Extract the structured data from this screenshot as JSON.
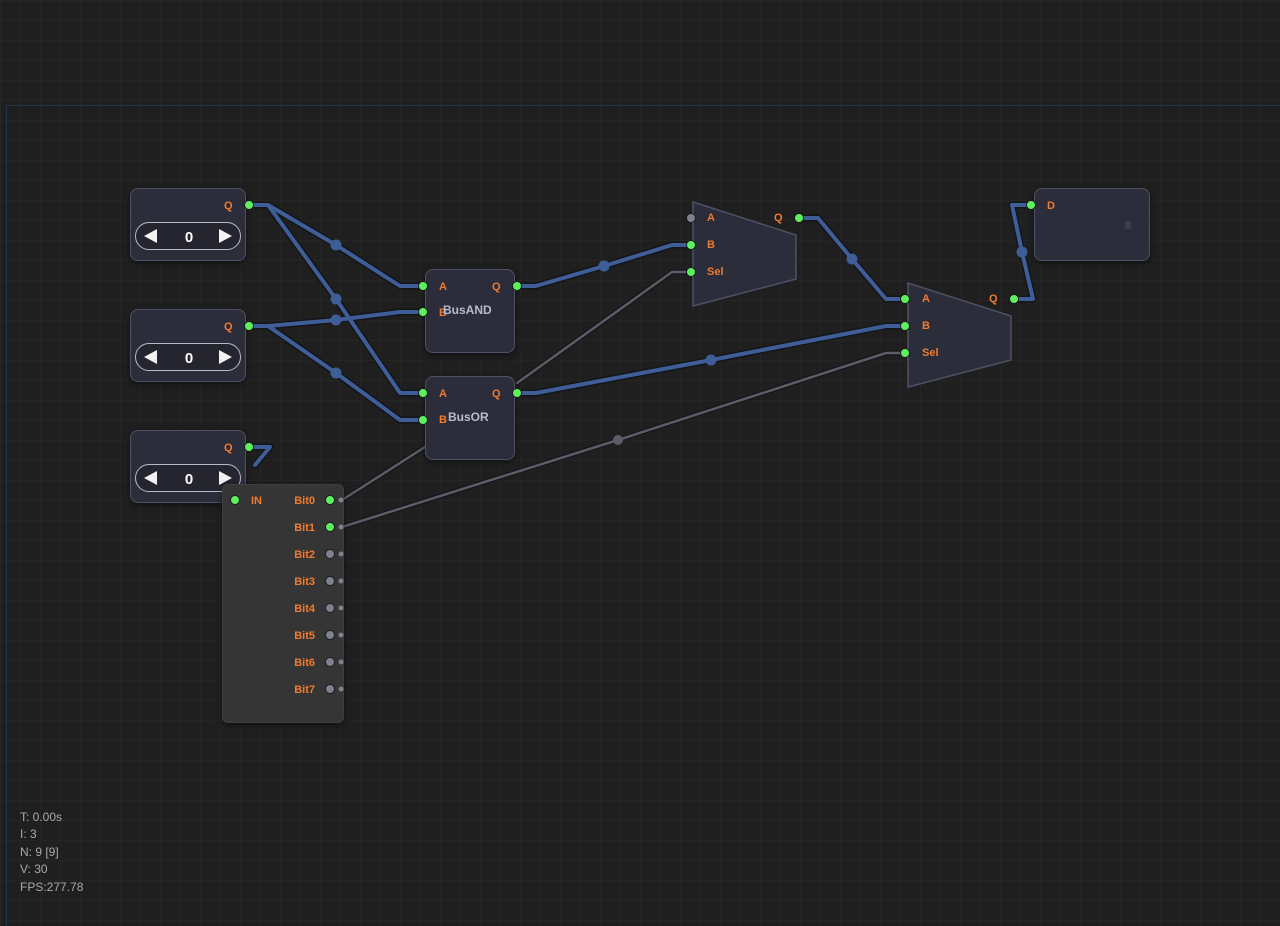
{
  "inputs": [
    {
      "output_label": "Q",
      "value": "0"
    },
    {
      "output_label": "Q",
      "value": "0"
    },
    {
      "output_label": "Q",
      "value": "0"
    }
  ],
  "gates": {
    "bus_and": {
      "name": "BusAND",
      "in_a": "A",
      "in_b": "B",
      "out": "Q"
    },
    "bus_or": {
      "name": "BusOR",
      "in_a": "A",
      "in_b": "B",
      "out": "Q"
    }
  },
  "mux1": {
    "in_a": "A",
    "in_b": "B",
    "in_sel": "Sel",
    "out": "Q"
  },
  "mux2": {
    "in_a": "A",
    "in_b": "B",
    "in_sel": "Sel",
    "out": "Q"
  },
  "splitter": {
    "input_label": "IN",
    "outputs": [
      "Bit0",
      "Bit1",
      "Bit2",
      "Bit3",
      "Bit4",
      "Bit5",
      "Bit6",
      "Bit7"
    ]
  },
  "display": {
    "input_label": "D"
  },
  "stats": {
    "time": "T: 0.00s",
    "iterations": "I: 3",
    "nodes": "N: 9 [9]",
    "vertices": "V: 30",
    "fps": "FPS:277.78"
  },
  "colors": {
    "port_active": "#5ef05e",
    "port_inactive": "#7e8190",
    "bus_wire": "#3f5d97",
    "signal_wire": "#5b5d66",
    "label": "#f07a2e"
  }
}
